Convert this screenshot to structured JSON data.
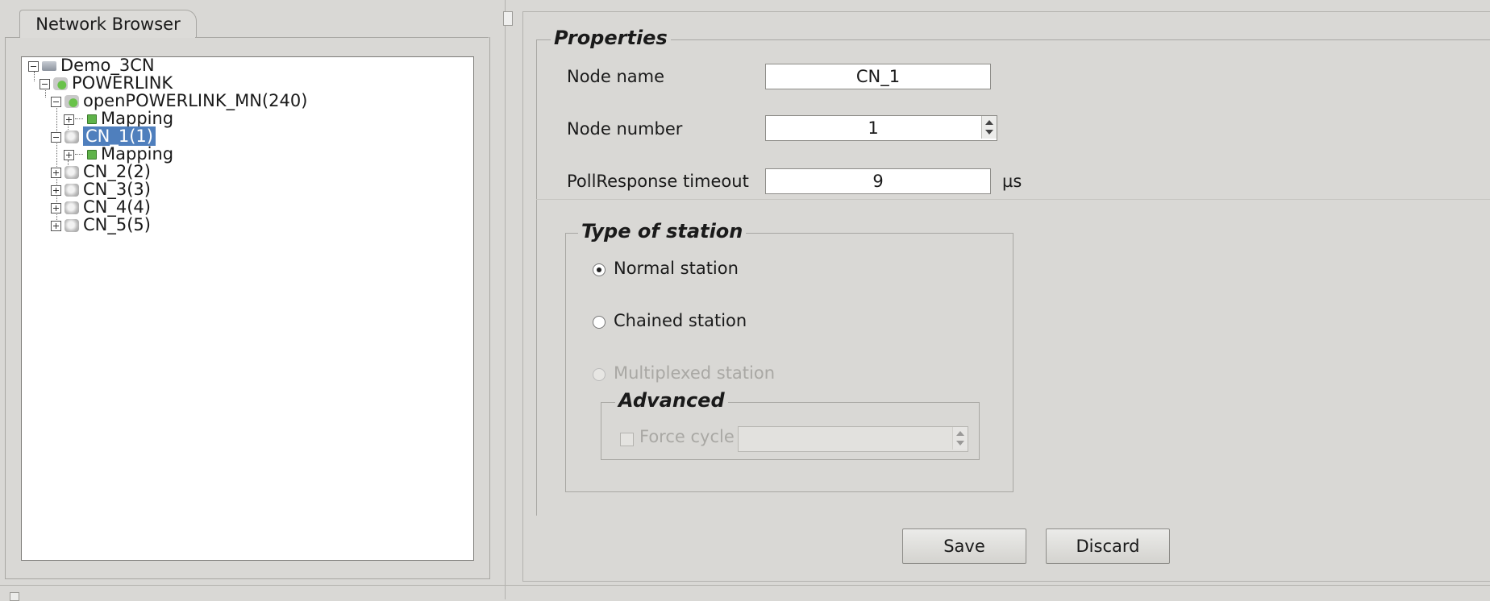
{
  "left_panel": {
    "tab_label": "Network Browser",
    "tree": [
      {
        "label": "Demo_3CN",
        "expander": "minus",
        "icon": "computer-icon",
        "level": 0
      },
      {
        "label": "POWERLINK",
        "expander": "minus",
        "icon": "network-icon",
        "level": 1
      },
      {
        "label": "openPOWERLINK_MN(240)",
        "expander": "minus",
        "icon": "managing-node-icon",
        "level": 2
      },
      {
        "label": "Mapping",
        "expander": "plus",
        "icon": "mapping-icon",
        "level": 3
      },
      {
        "label": "CN_1(1)",
        "expander": "minus",
        "icon": "controlled-node-icon",
        "level": 2,
        "selected": true
      },
      {
        "label": "Mapping",
        "expander": "plus",
        "icon": "mapping-icon",
        "level": 3
      },
      {
        "label": "CN_2(2)",
        "expander": "plus",
        "icon": "controlled-node-icon",
        "level": 2
      },
      {
        "label": "CN_3(3)",
        "expander": "plus",
        "icon": "controlled-node-icon",
        "level": 2
      },
      {
        "label": "CN_4(4)",
        "expander": "plus",
        "icon": "controlled-node-icon",
        "level": 2
      },
      {
        "label": "CN_5(5)",
        "expander": "plus",
        "icon": "controlled-node-icon",
        "level": 2
      }
    ]
  },
  "properties": {
    "title": "Properties",
    "node_name_label": "Node name",
    "node_name_value": "CN_1",
    "node_number_label": "Node number",
    "node_number_value": "1",
    "poll_label": "PollResponse timeout",
    "poll_value": "9",
    "poll_unit": "µs"
  },
  "station_type": {
    "title": "Type of station",
    "options": [
      {
        "label": "Normal station",
        "checked": true,
        "enabled": true
      },
      {
        "label": "Chained station",
        "checked": false,
        "enabled": true
      },
      {
        "label": "Multiplexed station",
        "checked": false,
        "enabled": false
      }
    ],
    "advanced": {
      "title": "Advanced",
      "force_cycle_label": "Force cycle",
      "force_cycle_checked": false,
      "force_cycle_value": ""
    }
  },
  "buttons": {
    "save_label": "Save",
    "discard_label": "Discard"
  },
  "colors": {
    "background": "#d9d8d5",
    "selection": "#4f7fbd"
  }
}
